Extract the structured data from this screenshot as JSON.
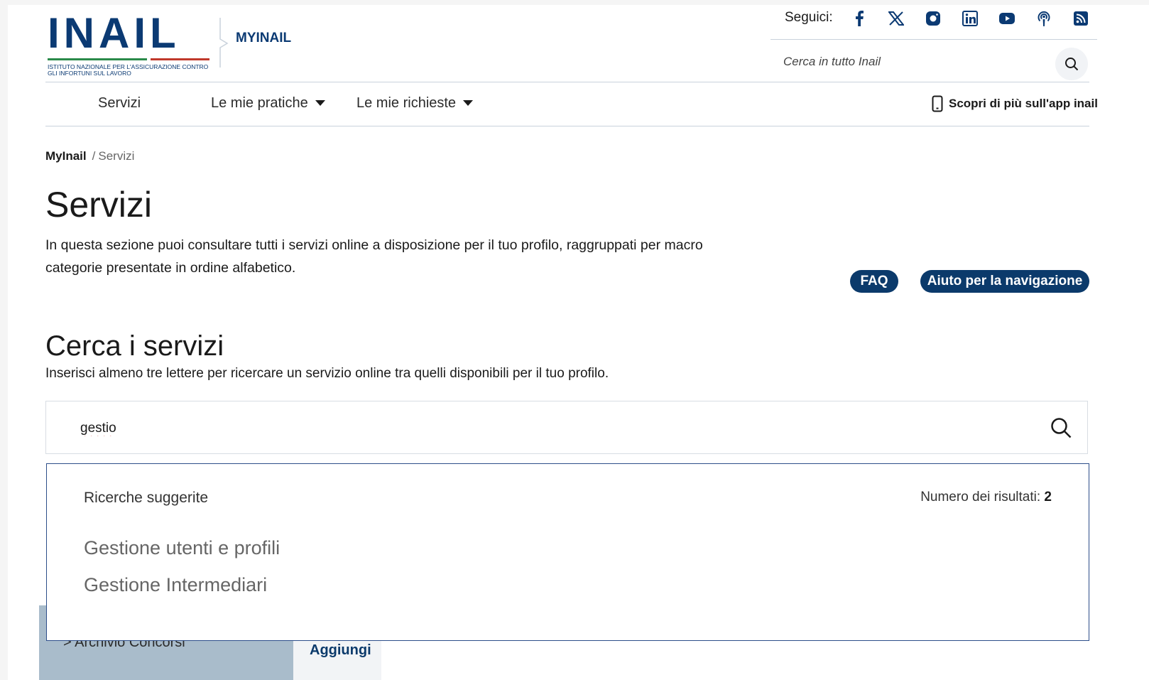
{
  "brand": {
    "logo_text": "INAIL",
    "logo_subtitle": "ISTITUTO NAZIONALE PER L'ASSICURAZIONE CONTRO GLI INFORTUNI SUL LAVORO",
    "name": "MYINAIL"
  },
  "social": {
    "label": "Seguici:",
    "icons": [
      "facebook-icon",
      "x-icon",
      "instagram-icon",
      "linkedin-icon",
      "youtube-icon",
      "podcast-icon",
      "rss-icon"
    ]
  },
  "site_search": {
    "placeholder": "Cerca in tutto Inail"
  },
  "nav": {
    "items": [
      {
        "label": "Servizi"
      },
      {
        "label": "Le mie pratiche"
      },
      {
        "label": "Le mie richieste"
      }
    ],
    "app_link": "Scopri di più sull'app inail"
  },
  "breadcrumb": {
    "home": "MyInail",
    "separator": "/",
    "current": "Servizi"
  },
  "page": {
    "title": "Servizi",
    "description": "In questa sezione puoi consultare tutti i servizi online a disposizione per il tuo profilo, raggruppati per macro categorie presentate in ordine alfabetico.",
    "faq": "FAQ",
    "help": "Aiuto per la navigazione"
  },
  "service_search": {
    "title": "Cerca i servizi",
    "hint": "Inserisci almeno tre lettere per ricercare un servizio online tra quelli disponibili per il tuo profilo.",
    "value": "gestio"
  },
  "suggestions": {
    "heading": "Ricerche suggerite",
    "count_label": "Numero dei risultati:",
    "count": "2",
    "items": [
      "Gestione utenti e profili",
      "Gestione Intermediari"
    ]
  },
  "background": {
    "menu_item": "> Archivio Concorsi",
    "add_button": "Aggiungi"
  },
  "colors": {
    "brand_blue": "#0b3a73",
    "pill_blue": "#0b3a6b",
    "dropdown_border": "#2d4e8a"
  }
}
